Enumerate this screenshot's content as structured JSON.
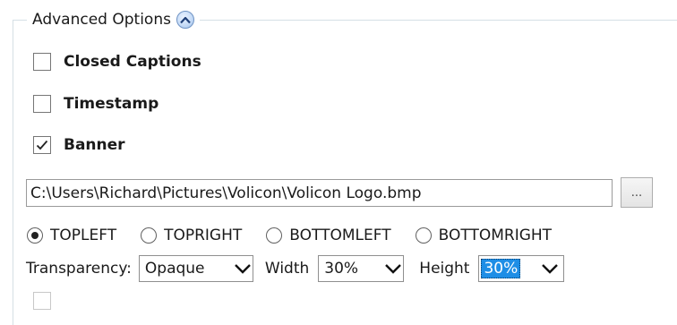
{
  "advanced_options": {
    "title": "Advanced Options"
  },
  "checkboxes": [
    {
      "label": "Closed Captions",
      "checked": false
    },
    {
      "label": "Timestamp",
      "checked": false
    },
    {
      "label": "Banner",
      "checked": true
    }
  ],
  "banner": {
    "file_path": "C:\\Users\\Richard\\Pictures\\Volicon\\Volicon Logo.bmp",
    "browse_label": "...",
    "positions": [
      {
        "label": "TOPLEFT",
        "selected": true
      },
      {
        "label": "TOPRIGHT",
        "selected": false
      },
      {
        "label": "BOTTOMLEFT",
        "selected": false
      },
      {
        "label": "BOTTOMRIGHT",
        "selected": false
      }
    ],
    "transparency_label": "Transparency:",
    "transparency_value": "Opaque",
    "width_label": "Width",
    "width_value": "30%",
    "height_label": "Height",
    "height_value": "30%"
  },
  "icons": {
    "collapse": "chevron-up-icon",
    "check": "check-icon",
    "dropdown": "chevron-down-icon"
  },
  "colors": {
    "selection": "#1e8ee6",
    "border": "#d5dfe5"
  }
}
